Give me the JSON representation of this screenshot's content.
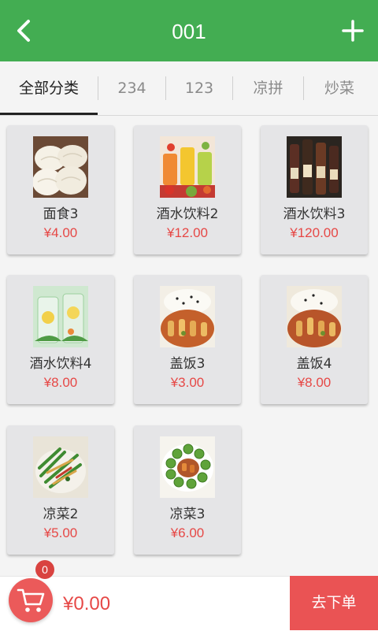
{
  "header": {
    "title": "001"
  },
  "tabs": [
    {
      "label": "全部分类",
      "active": true
    },
    {
      "label": "234"
    },
    {
      "label": "123"
    },
    {
      "label": "凉拼"
    },
    {
      "label": "炒菜"
    }
  ],
  "products": [
    {
      "name": "面食3",
      "price": "¥4.00",
      "image": "steamed-buns-image"
    },
    {
      "name": "酒水饮料2",
      "price": "¥12.00",
      "image": "juice-drinks-image"
    },
    {
      "name": "酒水饮料3",
      "price": "¥120.00",
      "image": "wine-bottles-image"
    },
    {
      "name": "酒水饮料4",
      "price": "¥8.00",
      "image": "lemon-drinks-image"
    },
    {
      "name": "盖饭3",
      "price": "¥3.00",
      "image": "rice-dish-image"
    },
    {
      "name": "盖饭4",
      "price": "¥8.00",
      "image": "rice-dish-image"
    },
    {
      "name": "凉菜2",
      "price": "¥5.00",
      "image": "cold-salad-image"
    },
    {
      "name": "凉菜3",
      "price": "¥6.00",
      "image": "cucumber-dish-image"
    }
  ],
  "cart": {
    "count": "0",
    "total": "¥0.00",
    "checkout_label": "去下单"
  },
  "colors": {
    "accent": "#43ad52",
    "price": "#e64846",
    "cart": "#eb5a5a"
  }
}
